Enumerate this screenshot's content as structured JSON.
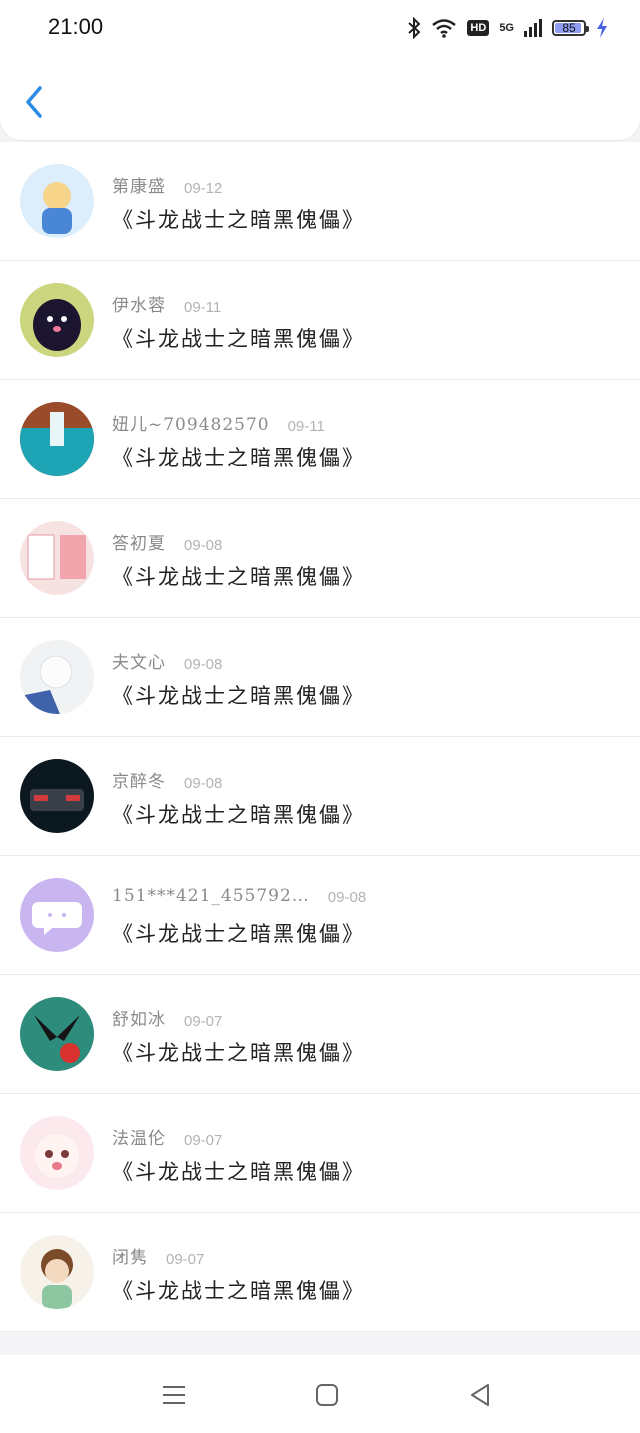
{
  "status_bar": {
    "time": "21:00",
    "network": "5G",
    "hd": "HD",
    "battery": "85",
    "icons": [
      "bluetooth-icon",
      "wifi-icon",
      "signal-icon",
      "charging-icon"
    ]
  },
  "header": {
    "back_icon": "chevron-left-icon"
  },
  "comments": [
    {
      "name": "第康盛",
      "date": "09-12",
      "title": "《斗龙战士之暗黑傀儡》",
      "avatar_colors": [
        "#b7dbf1",
        "#f1d77a"
      ]
    },
    {
      "name": "伊水蓉",
      "date": "09-11",
      "title": "《斗龙战士之暗黑傀儡》",
      "avatar_colors": [
        "#c8d87a",
        "#1a1530"
      ]
    },
    {
      "name": "妞儿~709482570",
      "date": "09-11",
      "title": "《斗龙战士之暗黑傀儡》",
      "avatar_colors": [
        "#1ea5b5",
        "#a84b2a"
      ]
    },
    {
      "name": "答初夏",
      "date": "09-08",
      "title": "《斗龙战士之暗黑傀儡》",
      "avatar_colors": [
        "#f6d8d8",
        "#e06a72"
      ]
    },
    {
      "name": "夫文心",
      "date": "09-08",
      "title": "《斗龙战士之暗黑傀儡》",
      "avatar_colors": [
        "#eef0f2",
        "#4a6fb8"
      ]
    },
    {
      "name": "京醉冬",
      "date": "09-08",
      "title": "《斗龙战士之暗黑傀儡》",
      "avatar_colors": [
        "#0c1a22",
        "#c9363a"
      ]
    },
    {
      "name": "151***421_455792…",
      "date": "09-08",
      "title": "《斗龙战士之暗黑傀儡》",
      "avatar_colors": [
        "#c9b6f0",
        "#ffffff"
      ]
    },
    {
      "name": "舒如冰",
      "date": "09-07",
      "title": "《斗龙战士之暗黑傀儡》",
      "avatar_colors": [
        "#2e8c7c",
        "#d8312e"
      ]
    },
    {
      "name": "法温伦",
      "date": "09-07",
      "title": "《斗龙战士之暗黑傀儡》",
      "avatar_colors": [
        "#fbe9ee",
        "#f2a3b3"
      ]
    },
    {
      "name": "闭隽",
      "date": "09-07",
      "title": "《斗龙战士之暗黑傀儡》",
      "avatar_colors": [
        "#f3efe6",
        "#7c4b2a"
      ]
    }
  ],
  "nav_bar": {
    "icons": [
      "menu-icon",
      "home-icon",
      "back-triangle-icon"
    ]
  }
}
